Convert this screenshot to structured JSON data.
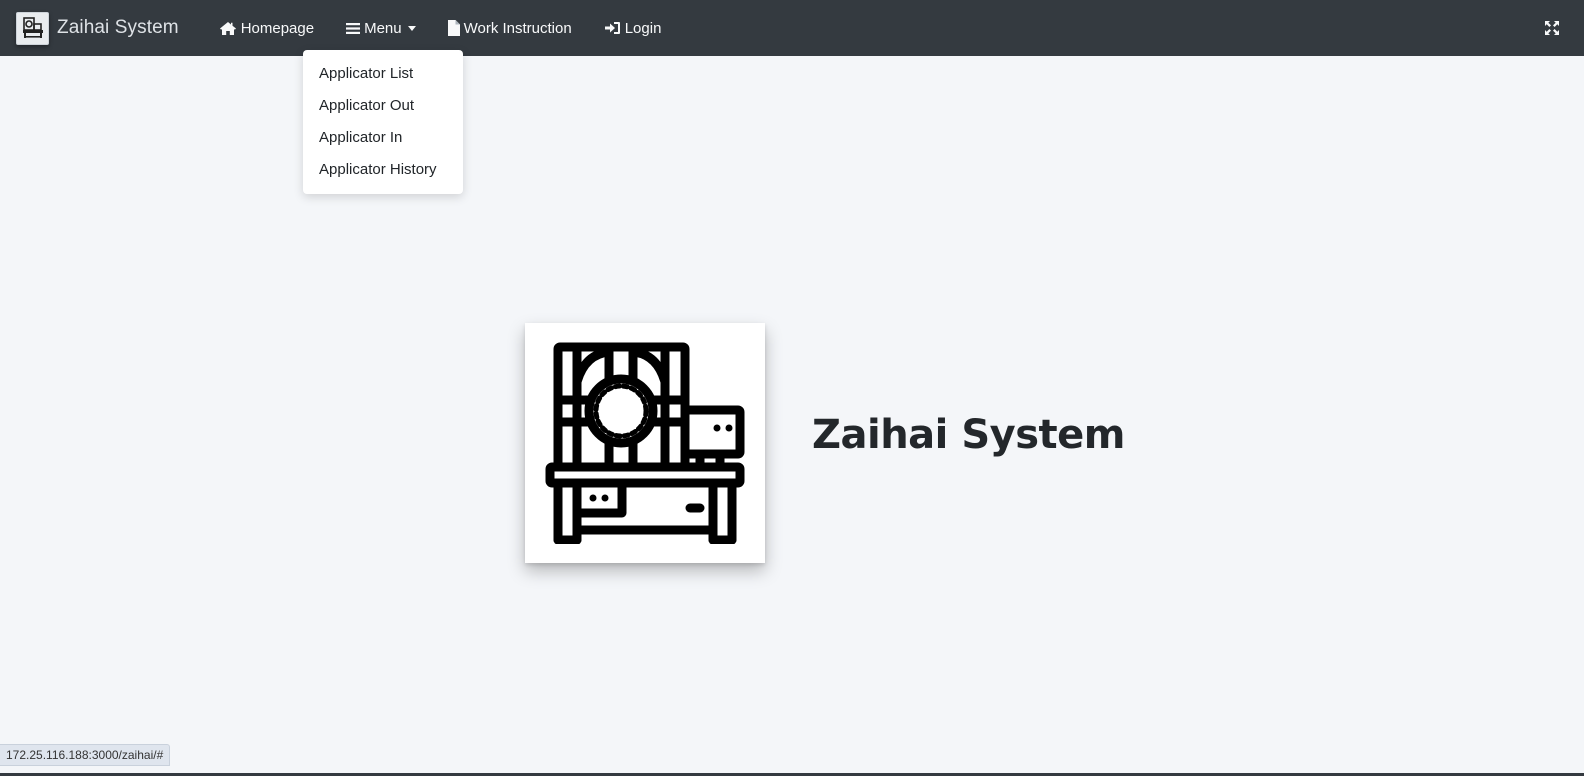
{
  "brand": {
    "name": "Zaihai System",
    "logo_icon": "machine-icon"
  },
  "nav": {
    "items": [
      {
        "label": "Homepage",
        "icon": "home-icon"
      },
      {
        "label": "Menu",
        "icon": "bars-icon"
      },
      {
        "label": "Work Instruction",
        "icon": "file-icon"
      },
      {
        "label": "Login",
        "icon": "sign-in-icon"
      }
    ],
    "expand_icon": "expand-arrows-icon"
  },
  "dropdown": {
    "items": [
      {
        "label": "Applicator List"
      },
      {
        "label": "Applicator Out"
      },
      {
        "label": "Applicator In"
      },
      {
        "label": "Applicator History"
      }
    ]
  },
  "hero": {
    "title": "Zaihai System",
    "image_icon": "applicator-machine-icon"
  },
  "status_bar": {
    "url": "172.25.116.188:3000/zaihai/#"
  },
  "colors": {
    "navbar": "#343a40",
    "background": "#f4f6f9",
    "dropdown": "#ffffff"
  }
}
